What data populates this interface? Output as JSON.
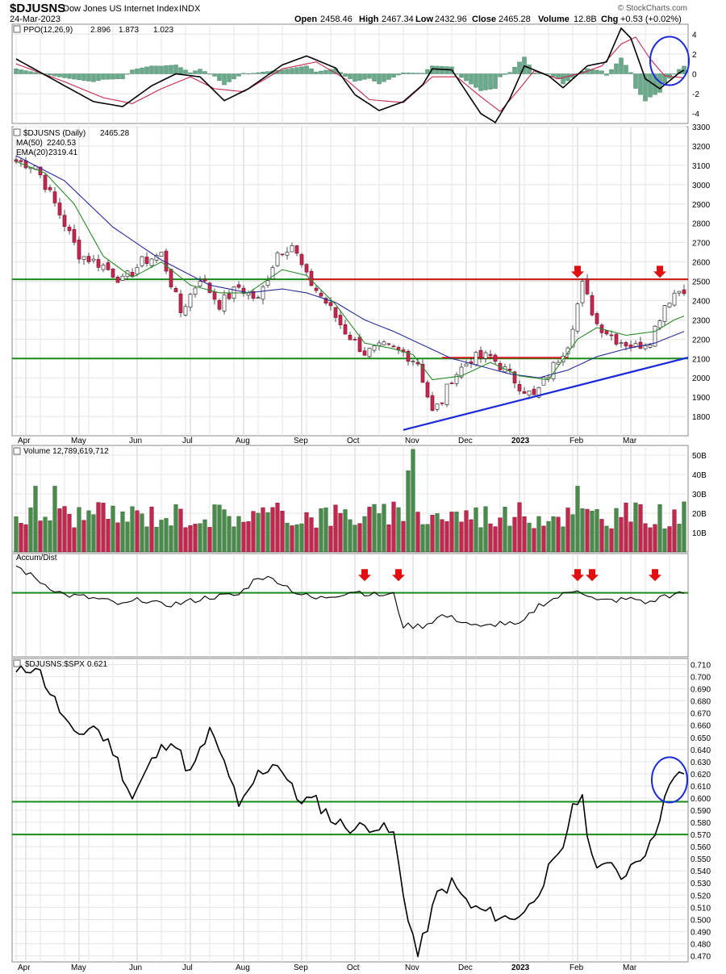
{
  "header": {
    "symbol": "$DJUSNS",
    "name": "Dow Jones US Internet Index",
    "exchange": "INDX",
    "date": "24-Mar-2023",
    "open_label": "Open",
    "open": "2458.46",
    "high_label": "High",
    "high": "2467.34",
    "low_label": "Low",
    "low": "2432.96",
    "close_label": "Close",
    "close": "2465.28",
    "volume_label": "Volume",
    "volume": "12.8B",
    "chg_label": "Chg",
    "chg": "+0.53 (+0.02%)",
    "watermark": "© StockCharts.com"
  },
  "colors": {
    "up": "#4a8a4a",
    "down": "#c2284e",
    "ma50": "#2b2b9a",
    "ema20": "#2a8a2a",
    "ppo": "#000000",
    "signal": "#c2284e",
    "hist": "#6aa98b",
    "green_line": "#1a8a1a",
    "red_line": "#d41a1a",
    "blue": "#1a2ad8",
    "arrow": "#e01010"
  },
  "x_labels": [
    "Apr",
    "May",
    "Jun",
    "Jul",
    "Aug",
    "Sep",
    "Oct",
    "Nov",
    "Dec",
    "2023",
    "Feb",
    "Mar"
  ],
  "chart_data": [
    {
      "type": "line",
      "panel": "ppo",
      "legend": "PPO(12,26,9)",
      "values_text": [
        "2.896",
        "1.873",
        "1.023"
      ],
      "ylim": [
        -5,
        5
      ],
      "yticks": [
        4,
        2,
        0,
        -2,
        -4
      ],
      "series": [
        {
          "name": "PPO(12,26,9)",
          "anchors": [
            [
              0,
              1.5
            ],
            [
              10,
              -1.2
            ],
            [
              16,
              -2.8
            ],
            [
              22,
              -3.3
            ],
            [
              28,
              -1.2
            ],
            [
              33,
              0
            ],
            [
              38,
              -0.3
            ],
            [
              43,
              -2.7
            ],
            [
              48,
              -1.5
            ],
            [
              55,
              0.9
            ],
            [
              60,
              1.8
            ],
            [
              66,
              0.6
            ],
            [
              70,
              -2.1
            ],
            [
              75,
              -3.7
            ],
            [
              80,
              -2.8
            ],
            [
              84,
              -1.1
            ],
            [
              86,
              0.5
            ],
            [
              90,
              0.4
            ],
            [
              93,
              -1.8
            ],
            [
              96,
              -4.0
            ],
            [
              99,
              -4.9
            ],
            [
              102,
              -2.5
            ],
            [
              105,
              0.8
            ],
            [
              110,
              -0.2
            ],
            [
              113,
              -1.4
            ],
            [
              118,
              0.8
            ],
            [
              122,
              1.2
            ],
            [
              125,
              4.6
            ],
            [
              127,
              3.6
            ],
            [
              130,
              -0.5
            ],
            [
              133,
              -1.5
            ],
            [
              137,
              0.1
            ],
            [
              141,
              1.2
            ],
            [
              143,
              2.9
            ]
          ]
        },
        {
          "name": "Signal",
          "anchors": [
            [
              0,
              1.0
            ],
            [
              10,
              -0.8
            ],
            [
              18,
              -2.4
            ],
            [
              24,
              -3.0
            ],
            [
              30,
              -1.5
            ],
            [
              36,
              -0.3
            ],
            [
              41,
              -1.5
            ],
            [
              47,
              -1.8
            ],
            [
              55,
              0.5
            ],
            [
              62,
              1.2
            ],
            [
              68,
              -0.5
            ],
            [
              73,
              -2.6
            ],
            [
              80,
              -2.9
            ],
            [
              86,
              -0.3
            ],
            [
              91,
              -0.3
            ],
            [
              96,
              -2.3
            ],
            [
              100,
              -3.8
            ],
            [
              104,
              -1.5
            ],
            [
              107,
              0.3
            ],
            [
              112,
              -0.5
            ],
            [
              117,
              0.1
            ],
            [
              121,
              0.8
            ],
            [
              125,
              3.0
            ],
            [
              128,
              3.7
            ],
            [
              131,
              1.5
            ],
            [
              134,
              -0.2
            ],
            [
              138,
              -0.4
            ],
            [
              141,
              0.4
            ],
            [
              143,
              1.9
            ]
          ]
        }
      ]
    },
    {
      "type": "candlestick",
      "panel": "price",
      "legend": "$DJUSNS (Daily)",
      "legend_value": "2465.28",
      "ma50_label": "MA(50)",
      "ma50_value": "2240.53",
      "ema20_label": "EMA(20)",
      "ema20_value": "2319.41",
      "ylim": [
        1700,
        3300
      ],
      "yticks": [
        3300,
        3200,
        3100,
        3000,
        2900,
        2800,
        2700,
        2600,
        2500,
        2400,
        2300,
        2200,
        2100,
        2000,
        1900,
        1800
      ],
      "close_anchors": [
        [
          0,
          3120
        ],
        [
          4,
          3100
        ],
        [
          8,
          2900
        ],
        [
          13,
          2640
        ],
        [
          18,
          2580
        ],
        [
          22,
          2500
        ],
        [
          26,
          2600
        ],
        [
          30,
          2640
        ],
        [
          34,
          2340
        ],
        [
          38,
          2520
        ],
        [
          42,
          2380
        ],
        [
          46,
          2470
        ],
        [
          50,
          2400
        ],
        [
          54,
          2650
        ],
        [
          57,
          2690
        ],
        [
          60,
          2520
        ],
        [
          64,
          2390
        ],
        [
          68,
          2240
        ],
        [
          72,
          2130
        ],
        [
          76,
          2160
        ],
        [
          80,
          2130
        ],
        [
          83,
          2080
        ],
        [
          86,
          1820
        ],
        [
          88,
          1880
        ],
        [
          90,
          2000
        ],
        [
          94,
          2100
        ],
        [
          98,
          2110
        ],
        [
          101,
          2040
        ],
        [
          104,
          1960
        ],
        [
          107,
          1900
        ],
        [
          110,
          2020
        ],
        [
          114,
          2180
        ],
        [
          117,
          2480
        ],
        [
          120,
          2280
        ],
        [
          124,
          2200
        ],
        [
          128,
          2160
        ],
        [
          131,
          2200
        ],
        [
          134,
          2380
        ],
        [
          136,
          2440
        ],
        [
          138,
          2465
        ]
      ],
      "ma50_anchors": [
        [
          0,
          3150
        ],
        [
          10,
          3020
        ],
        [
          20,
          2780
        ],
        [
          30,
          2610
        ],
        [
          40,
          2480
        ],
        [
          48,
          2440
        ],
        [
          55,
          2460
        ],
        [
          60,
          2440
        ],
        [
          66,
          2390
        ],
        [
          72,
          2300
        ],
        [
          78,
          2240
        ],
        [
          84,
          2170
        ],
        [
          90,
          2100
        ],
        [
          96,
          2060
        ],
        [
          102,
          2020
        ],
        [
          108,
          2000
        ],
        [
          114,
          2040
        ],
        [
          120,
          2110
        ],
        [
          126,
          2150
        ],
        [
          132,
          2180
        ],
        [
          136,
          2220
        ],
        [
          138,
          2240
        ]
      ],
      "ema20_anchors": [
        [
          0,
          3120
        ],
        [
          6,
          3060
        ],
        [
          12,
          2900
        ],
        [
          18,
          2630
        ],
        [
          24,
          2520
        ],
        [
          30,
          2600
        ],
        [
          36,
          2480
        ],
        [
          42,
          2440
        ],
        [
          48,
          2440
        ],
        [
          55,
          2560
        ],
        [
          60,
          2530
        ],
        [
          66,
          2380
        ],
        [
          72,
          2180
        ],
        [
          78,
          2150
        ],
        [
          82,
          2120
        ],
        [
          86,
          1990
        ],
        [
          92,
          2010
        ],
        [
          98,
          2080
        ],
        [
          104,
          2010
        ],
        [
          110,
          1990
        ],
        [
          116,
          2200
        ],
        [
          120,
          2260
        ],
        [
          126,
          2220
        ],
        [
          132,
          2240
        ],
        [
          136,
          2300
        ],
        [
          138,
          2320
        ]
      ],
      "red_resistance": 2510,
      "green_support": 2100,
      "green_upper": 2510,
      "trendline": [
        [
          80,
          1730
        ],
        [
          138,
          2105
        ]
      ],
      "arrows_at": [
        [
          116,
          2580
        ],
        [
          133,
          2580
        ]
      ]
    },
    {
      "type": "bar",
      "panel": "volume",
      "legend": "Volume 12,789,619,712",
      "unit": "B",
      "ylim": [
        0,
        55
      ],
      "yticks": [
        50,
        40,
        30,
        20,
        10
      ],
      "ytick_labels": [
        "50B",
        "40B",
        "30B",
        "20B",
        "10B"
      ]
    },
    {
      "type": "line",
      "panel": "accum",
      "legend": "Accum/Dist",
      "ylim": [
        0,
        100
      ],
      "green_level": 62,
      "anchors": [
        [
          0,
          88
        ],
        [
          6,
          70
        ],
        [
          10,
          60
        ],
        [
          14,
          58
        ],
        [
          18,
          55
        ],
        [
          22,
          50
        ],
        [
          26,
          56
        ],
        [
          30,
          50
        ],
        [
          34,
          52
        ],
        [
          40,
          58
        ],
        [
          46,
          60
        ],
        [
          50,
          78
        ],
        [
          54,
          74
        ],
        [
          58,
          62
        ],
        [
          62,
          56
        ],
        [
          66,
          60
        ],
        [
          70,
          64
        ],
        [
          74,
          60
        ],
        [
          78,
          60
        ],
        [
          80,
          30
        ],
        [
          84,
          30
        ],
        [
          88,
          40
        ],
        [
          92,
          35
        ],
        [
          96,
          28
        ],
        [
          100,
          33
        ],
        [
          104,
          30
        ],
        [
          108,
          50
        ],
        [
          112,
          58
        ],
        [
          116,
          66
        ],
        [
          120,
          54
        ],
        [
          124,
          55
        ],
        [
          128,
          56
        ],
        [
          131,
          52
        ],
        [
          134,
          60
        ],
        [
          136,
          59
        ],
        [
          138,
          62
        ]
      ],
      "arrows_at": [
        [
          72,
          85
        ],
        [
          79,
          85
        ],
        [
          116,
          85
        ],
        [
          119,
          85
        ],
        [
          132,
          85
        ]
      ]
    },
    {
      "type": "line",
      "panel": "ratio",
      "legend": "$DJUSNS:$SPX",
      "legend_value": "0.621",
      "ylim": [
        0.465,
        0.715
      ],
      "yticks": [
        0.71,
        0.7,
        0.69,
        0.68,
        0.67,
        0.66,
        0.65,
        0.64,
        0.63,
        0.62,
        0.61,
        0.6,
        0.59,
        0.58,
        0.57,
        0.56,
        0.55,
        0.54,
        0.53,
        0.52,
        0.51,
        0.5,
        0.49,
        0.48,
        0.47
      ],
      "ytick_labels": [
        "0.710",
        "0.700",
        "0.690",
        "0.680",
        "0.670",
        "0.660",
        "0.650",
        "0.640",
        "0.630",
        "0.620",
        "0.610",
        "0.600",
        "0.590",
        "0.580",
        "0.570",
        "0.560",
        "0.550",
        "0.540",
        "0.530",
        "0.520",
        "0.510",
        "0.500",
        "0.490",
        "0.480",
        "0.470"
      ],
      "green_levels": [
        0.597,
        0.57
      ],
      "anchors": [
        [
          0,
          0.702
        ],
        [
          4,
          0.71
        ],
        [
          8,
          0.68
        ],
        [
          12,
          0.65
        ],
        [
          16,
          0.66
        ],
        [
          20,
          0.64
        ],
        [
          24,
          0.6
        ],
        [
          28,
          0.63
        ],
        [
          32,
          0.65
        ],
        [
          36,
          0.62
        ],
        [
          40,
          0.655
        ],
        [
          44,
          0.62
        ],
        [
          46,
          0.59
        ],
        [
          50,
          0.62
        ],
        [
          54,
          0.63
        ],
        [
          58,
          0.6
        ],
        [
          62,
          0.597
        ],
        [
          66,
          0.58
        ],
        [
          70,
          0.575
        ],
        [
          74,
          0.578
        ],
        [
          78,
          0.57
        ],
        [
          80,
          0.52
        ],
        [
          83,
          0.47
        ],
        [
          87,
          0.52
        ],
        [
          90,
          0.53
        ],
        [
          94,
          0.51
        ],
        [
          98,
          0.505
        ],
        [
          102,
          0.5
        ],
        [
          106,
          0.51
        ],
        [
          110,
          0.54
        ],
        [
          113,
          0.555
        ],
        [
          115,
          0.597
        ],
        [
          117,
          0.597
        ],
        [
          119,
          0.55
        ],
        [
          122,
          0.545
        ],
        [
          125,
          0.535
        ],
        [
          128,
          0.55
        ],
        [
          131,
          0.56
        ],
        [
          134,
          0.6
        ],
        [
          136,
          0.615
        ],
        [
          138,
          0.621
        ]
      ]
    }
  ]
}
